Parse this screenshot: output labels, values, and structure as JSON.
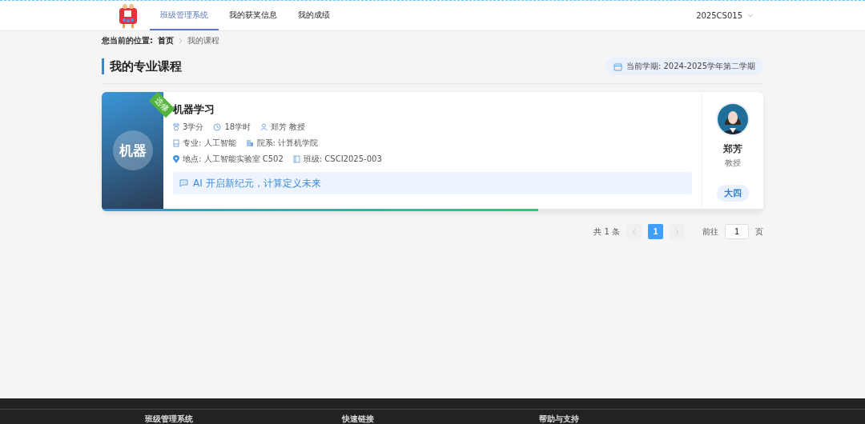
{
  "nav": {
    "items": [
      {
        "label": "班级管理系统",
        "selected": true
      },
      {
        "label": "我的获奖信息",
        "selected": false
      },
      {
        "label": "我的成绩",
        "selected": false
      }
    ],
    "user": "2025CS015"
  },
  "breadcrumb": {
    "label": "您当前的位置:",
    "items": [
      "首页",
      "我的课程"
    ]
  },
  "page_title": "我的专业课程",
  "semester": "当前学期: 2024-2025学年第二学期",
  "courses": [
    {
      "cover_text": "机器",
      "tag": "选修",
      "name": "机器学习",
      "credits": "3学分",
      "hours": "18学时",
      "teacher_line": "郑芳 教授",
      "major": "专业: 人工智能",
      "department": "院系: 计算机学院",
      "location": "地点: 人工智能实验室 C502",
      "class": "班级: CSCI2025-003",
      "motto": "AI 开启新纪元，计算定义未来",
      "teacher": {
        "name": "郑芳",
        "title": "教授"
      },
      "grade": "大四",
      "level": 0.66
    }
  ],
  "pagination": {
    "total": "共 1 条",
    "pages": [
      {
        "label": "1",
        "selected": true
      }
    ],
    "goto_label": "前往",
    "goto_value": "1",
    "goto_suffix": "页"
  },
  "footer": {
    "headings": [
      "班级管理系统",
      "快速链接",
      "帮助与支持"
    ]
  }
}
